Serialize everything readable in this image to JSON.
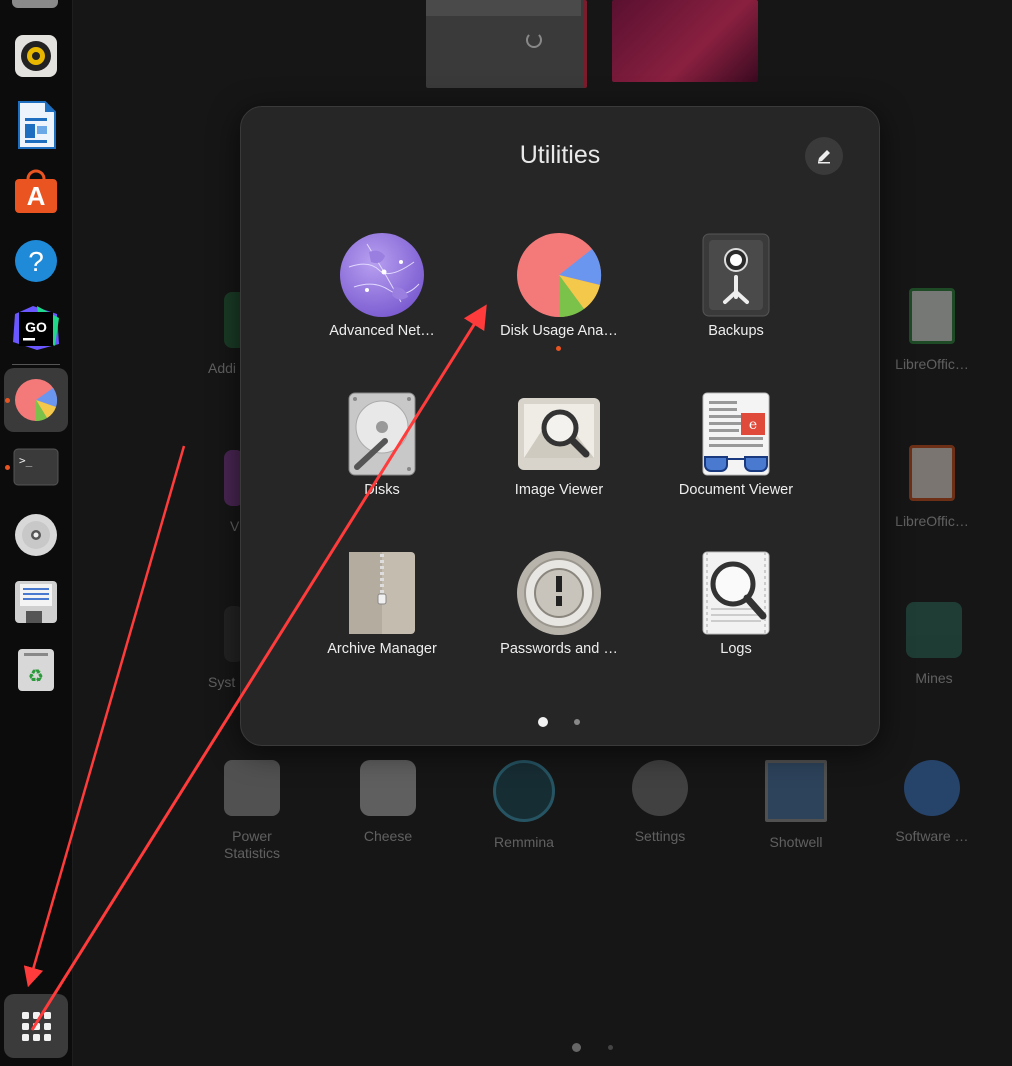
{
  "folder": {
    "title": "Utilities",
    "rename_icon": "pencil-icon",
    "apps": [
      {
        "name": "Advanced Net…",
        "icon": "network-globe-icon"
      },
      {
        "name": "Disk Usage Ana…",
        "icon": "pie-chart-icon",
        "running": true
      },
      {
        "name": "Backups",
        "icon": "safe-icon"
      },
      {
        "name": "Disks",
        "icon": "hard-disk-icon"
      },
      {
        "name": "Image Viewer",
        "icon": "image-magnifier-icon"
      },
      {
        "name": "Document Viewer",
        "icon": "document-glasses-icon"
      },
      {
        "name": "Archive Manager",
        "icon": "zip-archive-icon"
      },
      {
        "name": "Passwords and …",
        "icon": "keyring-icon"
      },
      {
        "name": "Logs",
        "icon": "log-magnifier-icon"
      }
    ],
    "pages": 2,
    "current_page": 1
  },
  "background_apps": [
    {
      "name": "Addi",
      "icon": "spreadsheet-icon"
    },
    {
      "name": "LibreOffic…",
      "icon": "libreoffice-calc-icon"
    },
    {
      "name": "V",
      "icon": "app-icon"
    },
    {
      "name": "LibreOffic…",
      "icon": "libreoffice-impress-icon"
    },
    {
      "name": "Syst",
      "icon": "system-monitor-icon"
    },
    {
      "name": "Mines",
      "icon": "mines-icon"
    },
    {
      "name": "Power\nStatistics",
      "line1": "Power",
      "line2": "Statistics",
      "icon": "power-statistics-icon"
    },
    {
      "name": "Cheese",
      "icon": "webcam-icon"
    },
    {
      "name": "Remmina",
      "icon": "remote-desktop-icon"
    },
    {
      "name": "Settings",
      "icon": "gear-icon"
    },
    {
      "name": "Shotwell",
      "icon": "photo-tree-icon"
    },
    {
      "name": "Software …",
      "icon": "software-store-icon"
    }
  ],
  "dock": {
    "items": [
      {
        "name": "Rhythmbox",
        "icon": "speaker-icon"
      },
      {
        "name": "LibreOffice Writer",
        "icon": "writer-icon"
      },
      {
        "name": "Ubuntu Software",
        "icon": "app-store-icon"
      },
      {
        "name": "Help",
        "icon": "help-icon"
      },
      {
        "name": "GoLand",
        "icon": "goland-icon"
      },
      {
        "name": "Disk Usage Analyzer",
        "icon": "pie-chart-icon",
        "running": true,
        "active": true
      },
      {
        "name": "Terminal",
        "icon": "terminal-icon",
        "running": true,
        "text": ">_"
      },
      {
        "name": "Disc",
        "icon": "cd-icon"
      },
      {
        "name": "Save",
        "icon": "floppy-icon"
      },
      {
        "name": "Trash",
        "icon": "trash-icon"
      }
    ],
    "show_apps_icon": "grid-icon"
  },
  "colors": {
    "accent": "#e95420",
    "annotation": "#ff3b3b",
    "folder_bg": "#262626"
  }
}
